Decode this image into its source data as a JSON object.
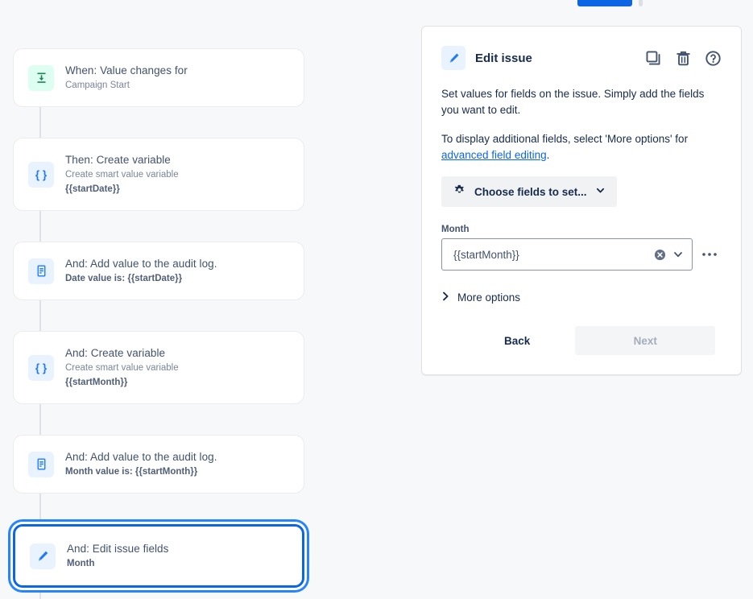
{
  "topbar": {
    "primary_button_label": "",
    "secondary_button_label": ""
  },
  "rule_chain": {
    "nodes": [
      {
        "title": "When: Value changes for",
        "subtitle": "Campaign Start",
        "subtitle_bold": false,
        "icon": "value-change-icon",
        "icon_tone": "green",
        "selected": false
      },
      {
        "title": "Then: Create variable",
        "subtitle": "Create smart value variable",
        "subtitle2": "{{startDate}}",
        "subtitle_bold": false,
        "icon": "curly-braces-icon",
        "icon_tone": "blue",
        "selected": false
      },
      {
        "title": "And: Add value to the audit log.",
        "subtitle": "Date value is: {{startDate}}",
        "subtitle_bold": true,
        "icon": "audit-log-icon",
        "icon_tone": "blue",
        "selected": false
      },
      {
        "title": "And: Create variable",
        "subtitle": "Create smart value variable",
        "subtitle2": "{{startMonth}}",
        "subtitle_bold": false,
        "icon": "curly-braces-icon",
        "icon_tone": "blue",
        "selected": false
      },
      {
        "title": "And: Add value to the audit log.",
        "subtitle": "Month value is: {{startMonth}}",
        "subtitle_bold": true,
        "icon": "audit-log-icon",
        "icon_tone": "blue",
        "selected": false
      },
      {
        "title": "And: Edit issue fields",
        "subtitle": "Month",
        "subtitle_bold": true,
        "icon": "pencil-icon",
        "icon_tone": "blue",
        "selected": true
      }
    ]
  },
  "panel": {
    "title": "Edit issue",
    "header_icon": "pencil-icon",
    "actions": [
      {
        "name": "duplicate-icon",
        "label": "Duplicate"
      },
      {
        "name": "trash-icon",
        "label": "Delete"
      },
      {
        "name": "help-icon",
        "label": "Help"
      }
    ],
    "description_1": "Set values for fields on the issue. Simply add the fields you want to edit.",
    "description_2_prefix": "To display additional fields, select 'More options' for ",
    "description_2_link": "advanced field editing",
    "description_2_suffix": ".",
    "choose_fields_label": "Choose fields to set...",
    "field": {
      "label": "Month",
      "value": "{{startMonth}}",
      "clear_icon": "clear-icon",
      "dropdown_icon": "chevron-down-icon",
      "more_icon": "more-horizontal-icon"
    },
    "more_options_label": "More options",
    "back_label": "Back",
    "next_label": "Next"
  },
  "colors": {
    "page_background": "#f7f8f9",
    "card_background": "#ffffff",
    "accent_blue": "#0c66e4",
    "selection_ring": "#2684ff",
    "icon_blue_bg": "#e9f2ff",
    "icon_green_bg": "#dcfff1",
    "text_primary": "#172b4d",
    "text_muted": "#7a869a",
    "connector": "#dfe1e6",
    "next_disabled_text": "#a5adba"
  }
}
